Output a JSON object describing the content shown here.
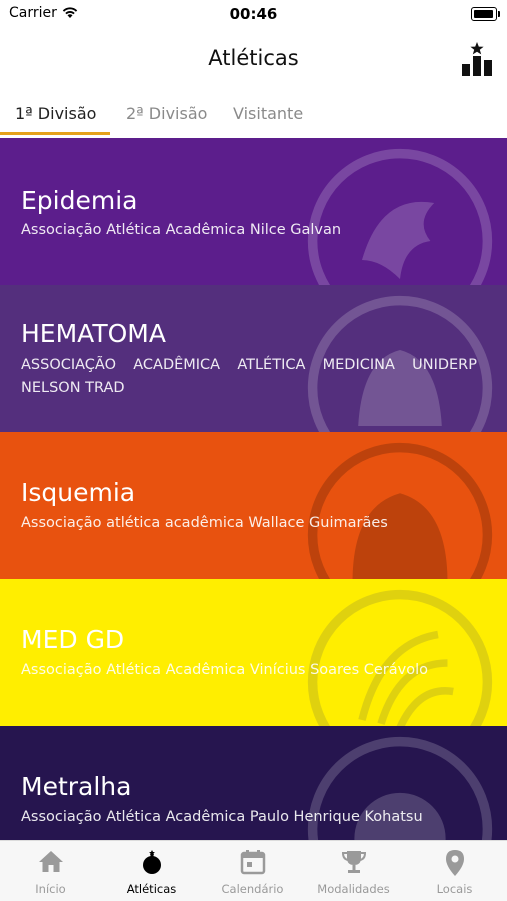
{
  "status": {
    "carrier": "Carrier",
    "time": "00:46"
  },
  "header": {
    "title": "Atléticas"
  },
  "tabs": [
    {
      "label": "1ª Divisão",
      "active": true
    },
    {
      "label": "2ª Divisão",
      "active": false
    },
    {
      "label": "Visitante",
      "active": false
    }
  ],
  "cards": [
    {
      "name": "Epidemia",
      "desc": "Associação Atlética Acadêmica Nilce Galvan",
      "color": "#5c1e8c"
    },
    {
      "name": "HEMATOMA",
      "desc": "ASSOCIAÇÃO ACADÊMICA ATLÉTICA MEDICINA UNIDERP NELSON TRAD",
      "color": "#542f7d"
    },
    {
      "name": "Isquemia",
      "desc": "Associação atlética acadêmica Wallace Guimarães",
      "color": "#e8520f"
    },
    {
      "name": "MED GD",
      "desc": "Associação Atlética Acadêmica Vinícius Soares Cerávolo",
      "color": "#ffee00"
    },
    {
      "name": "Metralha",
      "desc": "Associação Atlética Acadêmica Paulo Henrique Kohatsu",
      "color": "#26154f"
    }
  ],
  "tabbar": [
    {
      "label": "Início",
      "icon": "home-icon"
    },
    {
      "label": "Atléticas",
      "icon": "bomb-icon",
      "active": true
    },
    {
      "label": "Calendário",
      "icon": "calendar-icon"
    },
    {
      "label": "Modalidades",
      "icon": "trophy-icon"
    },
    {
      "label": "Locais",
      "icon": "location-pin-icon"
    }
  ]
}
